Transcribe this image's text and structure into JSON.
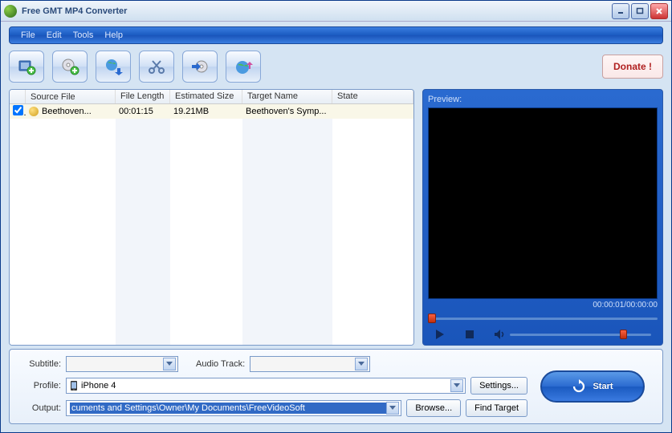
{
  "title": "Free GMT MP4 Converter",
  "menubar": {
    "file": "File",
    "edit": "Edit",
    "tools": "Tools",
    "help": "Help"
  },
  "donate": "Donate !",
  "columns": {
    "source": "Source File",
    "length": "File Length",
    "size": "Estimated Size",
    "target": "Target Name",
    "state": "State"
  },
  "rows": [
    {
      "checked": true,
      "source": "Beethoven...",
      "length": "00:01:15",
      "size": "19.21MB",
      "target": "Beethoven's Symp...",
      "state": ""
    }
  ],
  "preview": {
    "label": "Preview:",
    "time": "00:00:01/00:00:00"
  },
  "form": {
    "subtitle_label": "Subtitle:",
    "subtitle_value": "",
    "audio_label": "Audio Track:",
    "audio_value": "",
    "profile_label": "Profile:",
    "profile_value": "iPhone 4",
    "output_label": "Output:",
    "output_value": "cuments and Settings\\Owner\\My Documents\\FreeVideoSoft",
    "settings": "Settings...",
    "browse": "Browse...",
    "find_target": "Find Target"
  },
  "start": "Start"
}
